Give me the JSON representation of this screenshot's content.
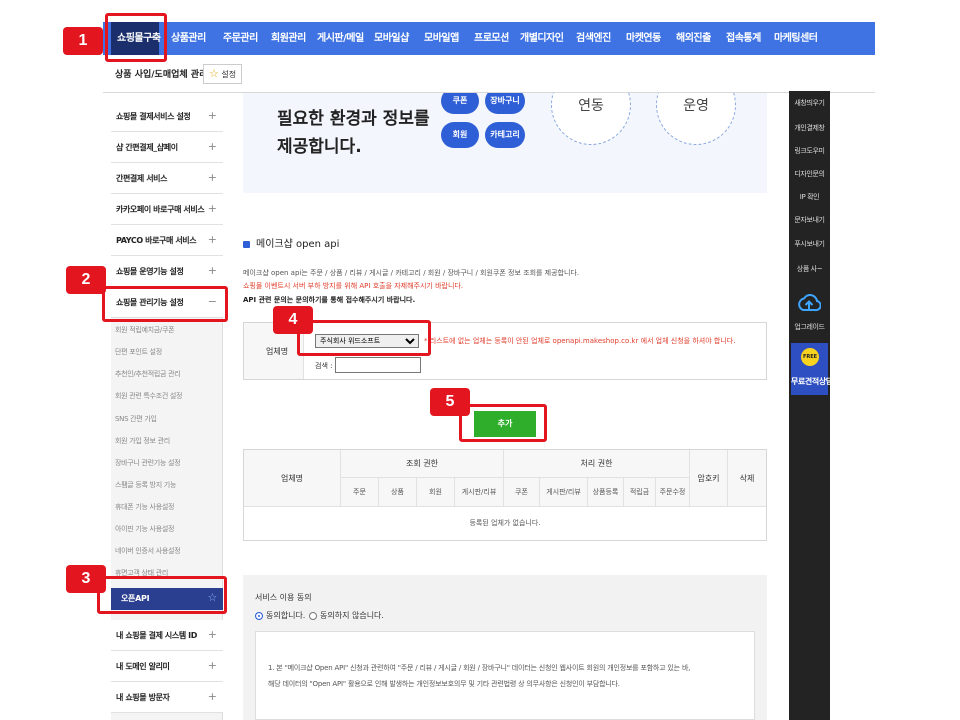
{
  "topnav": {
    "items": [
      "쇼핑몰구축",
      "상품관리",
      "주문관리",
      "회원관리",
      "게시판/메일",
      "모바일샵",
      "모바일앱",
      "프로모션",
      "개별디자인",
      "검색엔진",
      "마켓연동",
      "해외진출",
      "접속통계",
      "마케팅센터"
    ]
  },
  "subheader": {
    "title": "상품 사입/도매업체 관리",
    "fav_label": "설정"
  },
  "sidebar": {
    "items": [
      "쇼핑몰 결제서비스 설정",
      "샵 간편결제_샵페이",
      "간편결제 서비스",
      "카카오페이 바로구매 서비스",
      "PAYCO 바로구매 서비스",
      "쇼핑몰 운영기능 설정",
      "쇼핑몰 관리기능 설정"
    ],
    "subitems": [
      "회원 적립예치금/쿠폰",
      "단편 포인트 설정",
      "추천인/추천적립금 관리",
      "회원 관련 특수조건 설정",
      "SNS 간편 가입",
      "회원 가입 정보 관리",
      "장바구니 관련기능 설정",
      "스팸글 등록 방지 기능",
      "휴대폰 기능 사용설정",
      "아이핀 기능 사용설정",
      "네이버 인증서 사용설정",
      "휴면고객 상태 관리"
    ],
    "active_sub": "오픈API",
    "bottom_items": [
      "내 쇼핑몰 결제 시스템 ID",
      "내 도메인 알리미",
      "내 쇼핑몰 방문자"
    ]
  },
  "banner": {
    "line1": "필요한 환경과 정보를",
    "line2": "제공합니다.",
    "pills": [
      "쿠폰",
      "장바구니",
      "회원",
      "카테고리"
    ],
    "circles": [
      "연동",
      "운영"
    ]
  },
  "section": {
    "title": "메이크샵 open api",
    "desc1": "메이크샵 open api는 주문 / 상품 / 리뷰 / 게시글 / 카테고리 / 회원 / 장바구니 / 회원쿠폰 정보 조회를 제공합니다.",
    "desc2": "쇼핑몰 이벤트시 서버 부하 방지를 위해 API 호출을 자제해주시기 바랍니다.",
    "desc3": "API 관련 문의는 문의하기를 통해 접수해주시기 바랍니다."
  },
  "form": {
    "label": "업체명",
    "selected": "주식회사 위드소프트",
    "note": "* 리스트에 없는 업체는 등록이 안된 업체로 openapi.makeshop.co.kr 에서 업체 신청을 하셔야 합니다.",
    "search_label": "검색 :",
    "search_value": ""
  },
  "add_button": "추가",
  "table": {
    "col_company": "업체명",
    "group_read": "조회 권한",
    "group_process": "처리 권한",
    "col_secret": "암호키",
    "col_delete": "삭제",
    "read_cols": [
      "주문",
      "상품",
      "회원",
      "게시판/리뷰"
    ],
    "process_cols": [
      "쿠폰",
      "게시판/리뷰",
      "상품등록",
      "적립금",
      "주문수정"
    ],
    "empty": "등록된 업체가 없습니다."
  },
  "agree": {
    "title": "서비스 이용 동의",
    "yes": "동의합니다.",
    "no": "동의하지 않습니다.",
    "line1": "1. 본 \"메이크샵 Open API\" 신청과 관련하여 \"주문 / 리뷰 / 게시글 / 회원 / 장바구니\" 데이터는 신청인 웹사이트 회원의 개인정보를 포함하고 있는 바,",
    "line2": "해당 데이터의 \"Open API\" 활용으로 인해 발생하는 개인정보보호의무 및 기타 관련법령 상 의무사항은 신청인이 부담합니다."
  },
  "rail": {
    "items": [
      "새창띄우기",
      "개인결제창",
      "링크도우미",
      "디자인문의",
      "IP 확인",
      "문자보내기",
      "푸시보내기",
      "상품 사~"
    ],
    "upgrade": "업그레이드",
    "free_badge": "FREE",
    "free_label": "무료견적상담"
  },
  "callouts": [
    "1",
    "2",
    "3",
    "4",
    "5"
  ]
}
